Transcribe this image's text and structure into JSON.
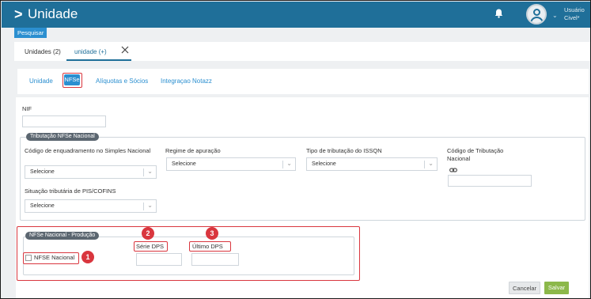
{
  "header": {
    "title": "Unidade",
    "user_line1": "Usuário",
    "user_line2": "Civel*"
  },
  "search": {
    "label": "Pesquisar"
  },
  "top_tabs": [
    {
      "label": "Unidades (2)"
    },
    {
      "label": "unidade (+)"
    }
  ],
  "inner_tabs": [
    {
      "label": "Unidade"
    },
    {
      "label": "NFSe"
    },
    {
      "label": "Alíquotas e Sócios"
    },
    {
      "label": "Integraçao Notazz"
    }
  ],
  "form": {
    "nif_label": "NIF",
    "tributacao": {
      "legend": "Tributação NFSe Nacional",
      "codigo_simples_label": "Código de enquadramento no Simples Nacional",
      "codigo_simples_value": "Selecione",
      "regime_label": "Regime de apuração",
      "regime_value": "Selecione",
      "tipo_issqn_label": "Tipo de tributação do ISSQN",
      "tipo_issqn_value": "Selecione",
      "codigo_trib_label": "Código de Tributação Nacional",
      "situacao_label": "Situação tributária de PIS/COFINS",
      "situacao_value": "Selecione"
    },
    "producao": {
      "legend": "NFSe Nacional - Produção",
      "nfse_checkbox_label": "NFSE Nacional",
      "serie_label": "Série DPS",
      "ultimo_label": "Último DPS"
    }
  },
  "badges": [
    "1",
    "2",
    "3"
  ],
  "buttons": {
    "cancel": "Cancelar",
    "save": "Salvar"
  },
  "colors": {
    "header": "#1f6f99",
    "accent": "#2b8fd0",
    "highlight": "#d9363e",
    "save": "#8cb84a"
  },
  "icons": {
    "back": "chevron-right-icon",
    "bell": "bell-icon",
    "user": "user-avatar-icon",
    "link": "link-icon",
    "close": "close-icon"
  }
}
